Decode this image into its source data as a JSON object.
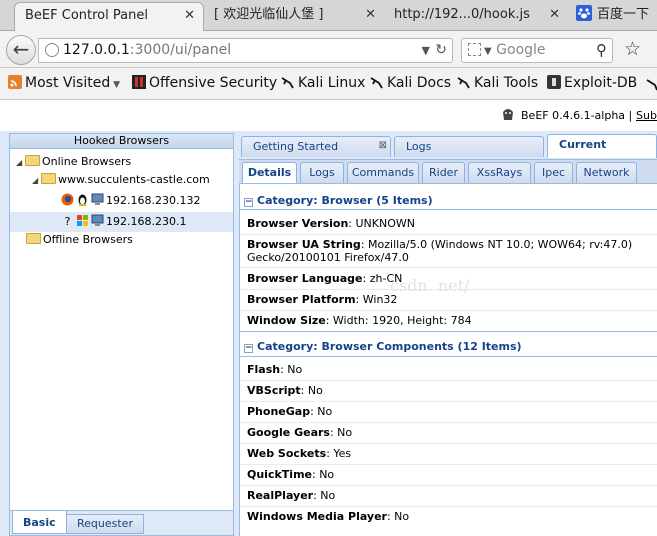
{
  "browser": {
    "tabs": [
      {
        "label": "BeEF Control Panel",
        "active": true
      },
      {
        "label": "[ 欢迎光临仙人堡 ]",
        "active": false
      },
      {
        "label": "http://192...0/hook.js",
        "active": false
      },
      {
        "label": "百度一下",
        "active": false
      }
    ],
    "url_host": "127.0.0.1",
    "url_rest": ":3000/ui/panel",
    "search_placeholder": "Google",
    "bookmarks": [
      "Most Visited",
      "Offensive Security",
      "Kali Linux",
      "Kali Docs",
      "Kali Tools",
      "Exploit-DB"
    ]
  },
  "beef": {
    "version": "BeEF   0.4.6.1-alpha   |",
    "submit": "Subm"
  },
  "left_panel": {
    "title": "Hooked Browsers",
    "online": "Online Browsers",
    "domain": "www.succulents-castle.com",
    "hosts": [
      "192.168.230.132",
      "192.168.230.1"
    ],
    "offline": "Offline Browsers",
    "footer_tabs": [
      "Basic",
      "Requester"
    ]
  },
  "top_tabs": [
    "Getting Started",
    "Logs",
    "Current Browser"
  ],
  "sub_tabs": [
    "Details",
    "Logs",
    "Commands",
    "Rider",
    "XssRays",
    "Ipec",
    "Network"
  ],
  "categories": [
    {
      "title": "Category: Browser (5 Items)",
      "rows": [
        {
          "k": "Browser Version",
          "v": ": UNKNOWN"
        },
        {
          "k": "Browser UA String",
          "v": ": Mozilla/5.0 (Windows NT 10.0; WOW64; rv:47.0)",
          "v2": "Gecko/20100101 Firefox/47.0"
        },
        {
          "k": "Browser Language",
          "v": ": zh-CN"
        },
        {
          "k": "Browser Platform",
          "v": ": Win32"
        },
        {
          "k": "Window Size",
          "v": ": Width: 1920, Height: 784"
        }
      ]
    },
    {
      "title": "Category: Browser Components (12 Items)",
      "rows": [
        {
          "k": "Flash",
          "v": ": No"
        },
        {
          "k": "VBScript",
          "v": ": No"
        },
        {
          "k": "PhoneGap",
          "v": ": No"
        },
        {
          "k": "Google Gears",
          "v": ": No"
        },
        {
          "k": "Web Sockets",
          "v": ": Yes"
        },
        {
          "k": "QuickTime",
          "v": ": No"
        },
        {
          "k": "RealPlayer",
          "v": ": No"
        },
        {
          "k": "Windows Media Player",
          "v": ": No"
        }
      ]
    }
  ],
  "watermark": "csdn. net/",
  "colors": {
    "accent": "#15428b",
    "panel_border": "#99bbe8",
    "panel_bg": "#dfe8f6"
  }
}
